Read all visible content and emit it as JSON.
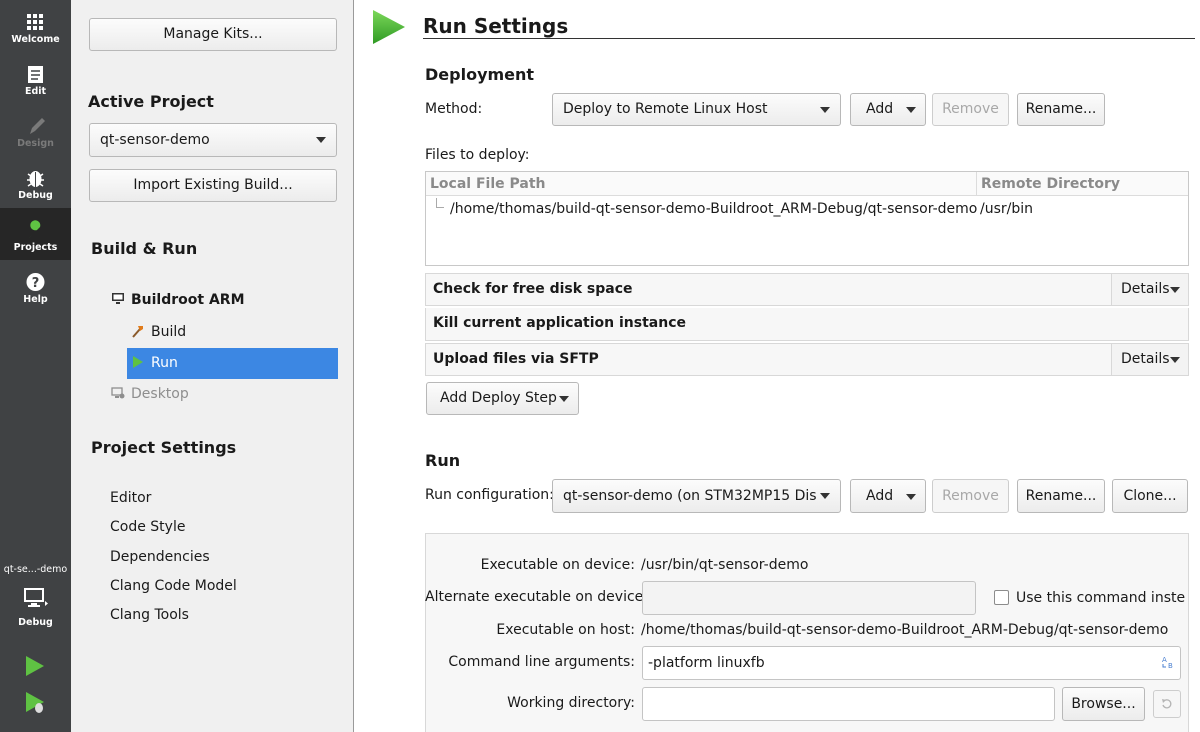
{
  "modebar": {
    "modes": [
      {
        "label": "Welcome",
        "icon": "grid-icon"
      },
      {
        "label": "Edit",
        "icon": "document-icon"
      },
      {
        "label": "Design",
        "icon": "pen-icon"
      },
      {
        "label": "Debug",
        "icon": "bug-icon"
      },
      {
        "label": "Projects",
        "icon": "wrench-icon"
      },
      {
        "label": "Help",
        "icon": "help-icon"
      }
    ],
    "kit_project": "qt-se...-demo",
    "kit_build": "Debug"
  },
  "left": {
    "manage_kits": "Manage Kits...",
    "active_project_title": "Active Project",
    "active_project_value": "qt-sensor-demo",
    "import_build": "Import Existing Build...",
    "build_run_title": "Build & Run",
    "kit_name": "Buildroot ARM",
    "build_item": "Build",
    "run_item": "Run",
    "desktop_item": "Desktop",
    "project_settings_title": "Project Settings",
    "settings_items": [
      "Editor",
      "Code Style",
      "Dependencies",
      "Clang Code Model",
      "Clang Tools"
    ]
  },
  "main": {
    "page_title": "Run Settings",
    "deployment": {
      "title": "Deployment",
      "method_label": "Method:",
      "method_value": "Deploy to Remote Linux Host",
      "add": "Add",
      "remove": "Remove",
      "rename": "Rename...",
      "files_label": "Files to deploy:",
      "columns": [
        "Local File Path",
        "Remote Directory"
      ],
      "files": [
        {
          "local": "/home/thomas/build-qt-sensor-demo-Buildroot_ARM-Debug/qt-sensor-demo",
          "remote": "/usr/bin"
        }
      ],
      "steps": [
        {
          "title": "Check for free disk space",
          "details": "Details"
        },
        {
          "title": "Kill current application instance",
          "details": ""
        },
        {
          "title": "Upload files via SFTP",
          "details": "Details"
        }
      ],
      "add_step": "Add Deploy Step"
    },
    "run": {
      "title": "Run",
      "config_label": "Run configuration:",
      "config_value": "qt-sensor-demo (on STM32MP15 Dis",
      "add": "Add",
      "remove": "Remove",
      "rename": "Rename...",
      "clone": "Clone...",
      "exec_device_label": "Executable on device:",
      "exec_device_value": "/usr/bin/qt-sensor-demo",
      "alt_exec_label": "Alternate executable on device:",
      "alt_exec_value": "",
      "use_command_label": "Use this command instead",
      "exec_host_label": "Executable on host:",
      "exec_host_value": "/home/thomas/build-qt-sensor-demo-Buildroot_ARM-Debug/qt-sensor-demo",
      "args_label": "Command line arguments:",
      "args_value": "-platform linuxfb",
      "workdir_label": "Working directory:",
      "workdir_value": "",
      "browse": "Browse..."
    }
  },
  "colors": {
    "modebar_bg": "#404244",
    "selection": "#3c87e3",
    "accent_green": "#3fa535"
  }
}
